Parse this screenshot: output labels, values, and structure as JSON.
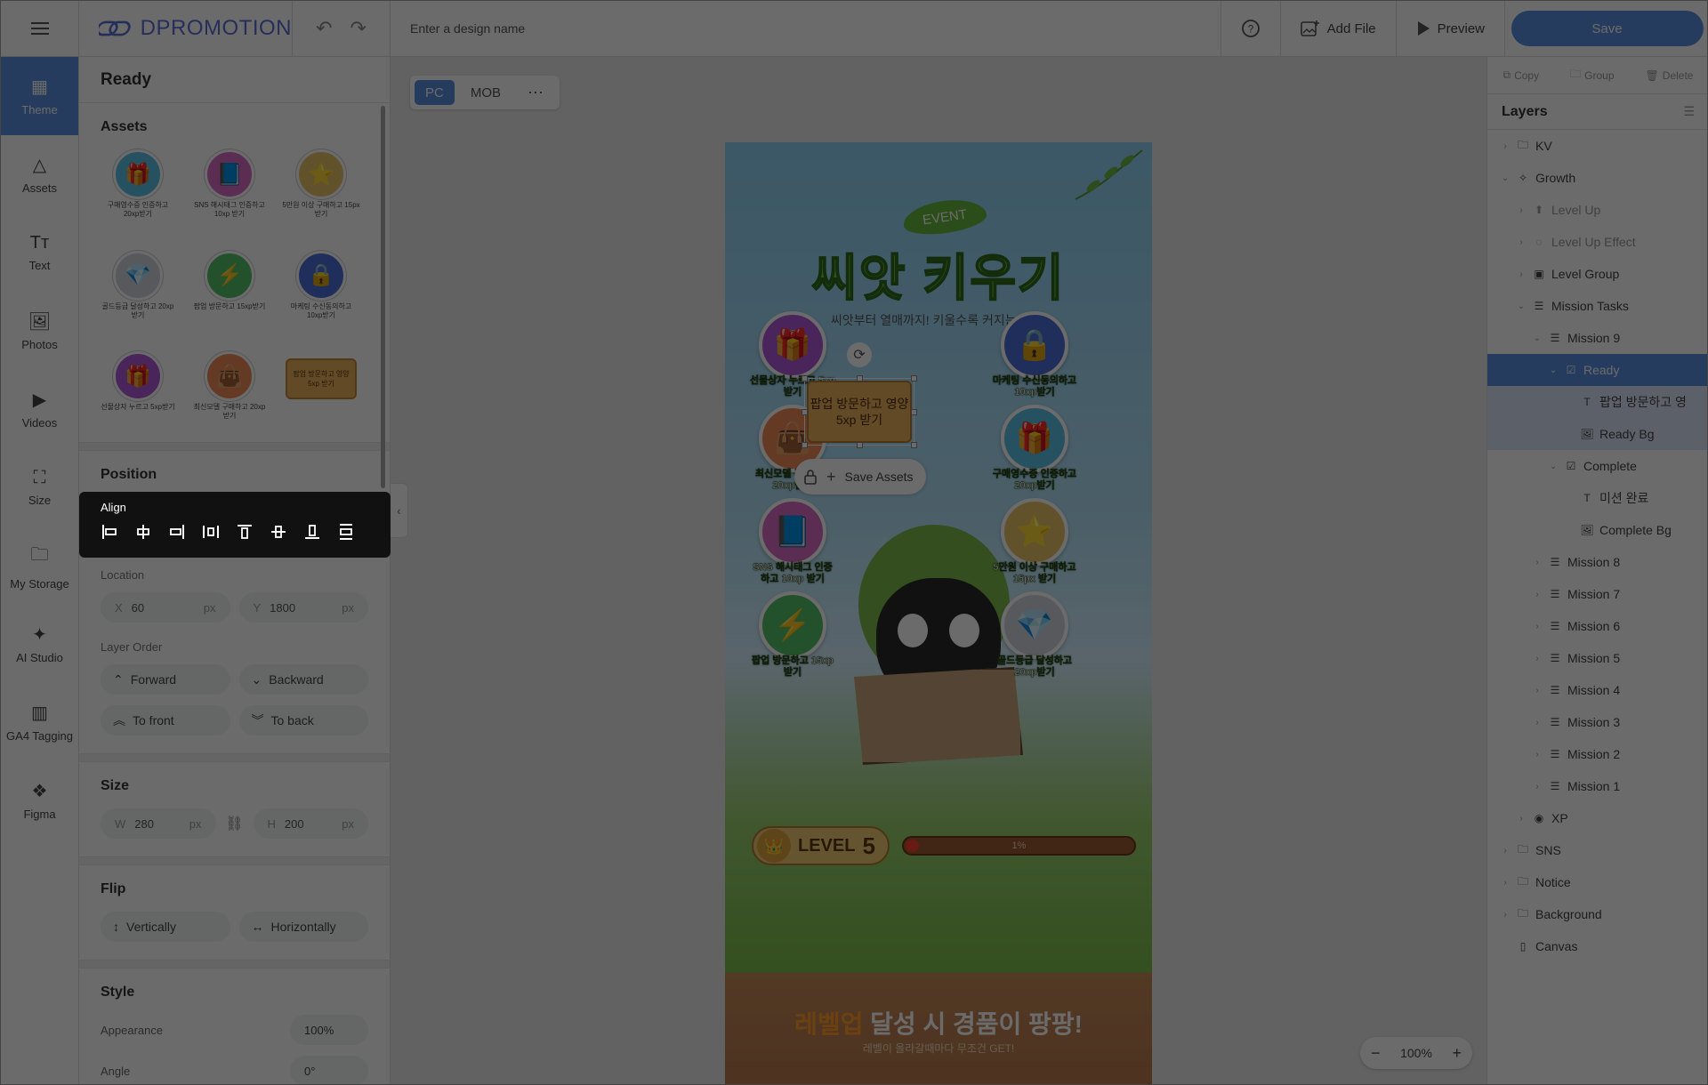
{
  "app": {
    "logo": "DPROMOTION",
    "design_name_placeholder": "Enter a design name"
  },
  "topbar": {
    "help_icon": "question-icon",
    "add_file": "Add File",
    "preview": "Preview",
    "save": "Save"
  },
  "left_nav": [
    {
      "label": "Theme",
      "icon": "theme-icon"
    },
    {
      "label": "Assets",
      "icon": "shapes-icon"
    },
    {
      "label": "Text",
      "icon": "text-icon"
    },
    {
      "label": "Photos",
      "icon": "image-icon"
    },
    {
      "label": "Videos",
      "icon": "video-icon"
    },
    {
      "label": "Size",
      "icon": "size-icon"
    },
    {
      "label": "My Storage",
      "icon": "folder-icon"
    },
    {
      "label": "AI Studio",
      "icon": "magic-wand-icon"
    },
    {
      "label": "GA4 Tagging",
      "icon": "bar-chart-icon"
    },
    {
      "label": "Figma",
      "icon": "figma-icon"
    }
  ],
  "panel": {
    "title": "Ready",
    "assets_title": "Assets",
    "assets": [
      {
        "label": "구매영수증 인증하고 20xp받기",
        "icon": "🎁",
        "color": "#5bc2e8"
      },
      {
        "label": "SNS 해시태그 인증하고 10xp 받기",
        "icon": "📘",
        "color": "#d86bc7"
      },
      {
        "label": "5만원 이상 구매하고 15px 받기",
        "icon": "⭐",
        "color": "#e8c36a"
      },
      {
        "label": "골드등급 달성하고 20xp받기",
        "icon": "💎",
        "color": "#cfd3dc"
      },
      {
        "label": "팝업 방문하고 15xp받기",
        "icon": "⚡",
        "color": "#55c266"
      },
      {
        "label": "마케팅 수신동의하고 10xp받기",
        "icon": "🔒",
        "color": "#4a6fd6"
      },
      {
        "label": "선물상자 누르고 5xp받기",
        "icon": "🎁",
        "color": "#b05ad8"
      },
      {
        "label": "최신모델 구매하고 20xp받기",
        "icon": "👜",
        "color": "#f08a5a"
      },
      {
        "label": "팝업 방문하고 영양 5xp 받기",
        "icon": "",
        "color": "#e8b15a"
      }
    ],
    "position_title": "Position",
    "align_label": "Align",
    "location_label": "Location",
    "x_key": "X",
    "x_value": "60",
    "y_key": "Y",
    "y_value": "1800",
    "unit": "px",
    "layer_order_label": "Layer Order",
    "forward": "Forward",
    "backward": "Backward",
    "to_front": "To front",
    "to_back": "To back",
    "size_title": "Size",
    "w_key": "W",
    "w_value": "280",
    "h_key": "H",
    "h_value": "200",
    "flip_title": "Flip",
    "vertically": "Vertically",
    "horizontally": "Horizontally",
    "style_title": "Style",
    "appearance_label": "Appearance",
    "appearance_value": "100%",
    "angle_label": "Angle",
    "angle_value": "0°"
  },
  "canvas": {
    "tabs": [
      "PC",
      "MOB"
    ],
    "event": "EVENT",
    "title": "씨앗 키우기",
    "subtitle": "씨앗부터 열매까지! 키울수록 커지는 혜택!",
    "missions": [
      {
        "label": "선물상자 누르고 5xp받기",
        "icon": "🎁",
        "color": "#b05ad8"
      },
      {
        "label": "마케팅 수신동의하고 10xp받기",
        "icon": "🔒",
        "color": "#4a6fd6"
      },
      {
        "label": "최신모델 구매하고 20xp받기",
        "icon": "👜",
        "color": "#f08a5a"
      },
      {
        "label": "구매영수증 인증하고 20xp받기",
        "icon": "🎁",
        "color": "#5bc2e8"
      },
      {
        "label": "SNS 해시태그 인증하고 10xp 받기",
        "icon": "📘",
        "color": "#d86bc7"
      },
      {
        "label": "5만원 이상 구매하고 15px 받기",
        "icon": "⭐",
        "color": "#e8c36a"
      },
      {
        "label": "팝업 방문하고 15xp받기",
        "icon": "⚡",
        "color": "#55c266"
      },
      {
        "label": "골드등급 달성하고 20xp받기",
        "icon": "💎",
        "color": "#cfd3dc"
      }
    ],
    "selected_tag": "팝업 방문하고 영양 5xp 받기",
    "save_assets": "Save Assets",
    "level_label": "LEVEL",
    "level_value": "5",
    "progress": 0.01,
    "progress_text": "1%",
    "bottom_highlight": "레벨업",
    "bottom_rest": " 달성 시 경품이 팡팡!",
    "bottom_sub": "레벨이 올라갈때마다 무조건 GET!",
    "zoom": "100%"
  },
  "right_panel": {
    "copy": "Copy",
    "group": "Group",
    "delete": "Delete",
    "layers_title": "Layers",
    "layers": [
      {
        "label": "KV",
        "indent": 0,
        "chev": "›",
        "icon": "folder",
        "state": ""
      },
      {
        "label": "Growth",
        "indent": 0,
        "chev": "⌄",
        "icon": "sparkle",
        "state": ""
      },
      {
        "label": "Level Up",
        "indent": 1,
        "chev": "›",
        "icon": "up",
        "state": "dim"
      },
      {
        "label": "Level Up Effect",
        "indent": 1,
        "chev": "›",
        "icon": "effect",
        "state": "dim"
      },
      {
        "label": "Level Group",
        "indent": 1,
        "chev": "›",
        "icon": "group",
        "state": ""
      },
      {
        "label": "Mission Tasks",
        "indent": 1,
        "chev": "⌄",
        "icon": "list",
        "state": ""
      },
      {
        "label": "Mission 9",
        "indent": 2,
        "chev": "⌄",
        "icon": "list",
        "state": ""
      },
      {
        "label": "Ready",
        "indent": 3,
        "chev": "⌄",
        "icon": "check",
        "state": "sel"
      },
      {
        "label": "팝업 방문하고 영",
        "indent": 4,
        "chev": "",
        "icon": "text",
        "state": "sub"
      },
      {
        "label": "Ready Bg",
        "indent": 4,
        "chev": "",
        "icon": "image",
        "state": "sub"
      },
      {
        "label": "Complete",
        "indent": 3,
        "chev": "⌄",
        "icon": "check",
        "state": ""
      },
      {
        "label": "미션 완료",
        "indent": 4,
        "chev": "",
        "icon": "text",
        "state": ""
      },
      {
        "label": "Complete Bg",
        "indent": 4,
        "chev": "",
        "icon": "image",
        "state": ""
      },
      {
        "label": "Mission 8",
        "indent": 2,
        "chev": "›",
        "icon": "list",
        "state": ""
      },
      {
        "label": "Mission 7",
        "indent": 2,
        "chev": "›",
        "icon": "list",
        "state": ""
      },
      {
        "label": "Mission 6",
        "indent": 2,
        "chev": "›",
        "icon": "list",
        "state": ""
      },
      {
        "label": "Mission 5",
        "indent": 2,
        "chev": "›",
        "icon": "list",
        "state": ""
      },
      {
        "label": "Mission 4",
        "indent": 2,
        "chev": "›",
        "icon": "list",
        "state": ""
      },
      {
        "label": "Mission 3",
        "indent": 2,
        "chev": "›",
        "icon": "list",
        "state": ""
      },
      {
        "label": "Mission 2",
        "indent": 2,
        "chev": "›",
        "icon": "list",
        "state": ""
      },
      {
        "label": "Mission 1",
        "indent": 2,
        "chev": "›",
        "icon": "list",
        "state": ""
      },
      {
        "label": "XP",
        "indent": 1,
        "chev": "›",
        "icon": "xp",
        "state": ""
      },
      {
        "label": "SNS",
        "indent": 0,
        "chev": "›",
        "icon": "folder",
        "state": ""
      },
      {
        "label": "Notice",
        "indent": 0,
        "chev": "›",
        "icon": "folder",
        "state": ""
      },
      {
        "label": "Background",
        "indent": 0,
        "chev": "›",
        "icon": "folder",
        "state": ""
      },
      {
        "label": "Canvas",
        "indent": 0,
        "chev": "",
        "icon": "canvas",
        "state": ""
      }
    ]
  }
}
